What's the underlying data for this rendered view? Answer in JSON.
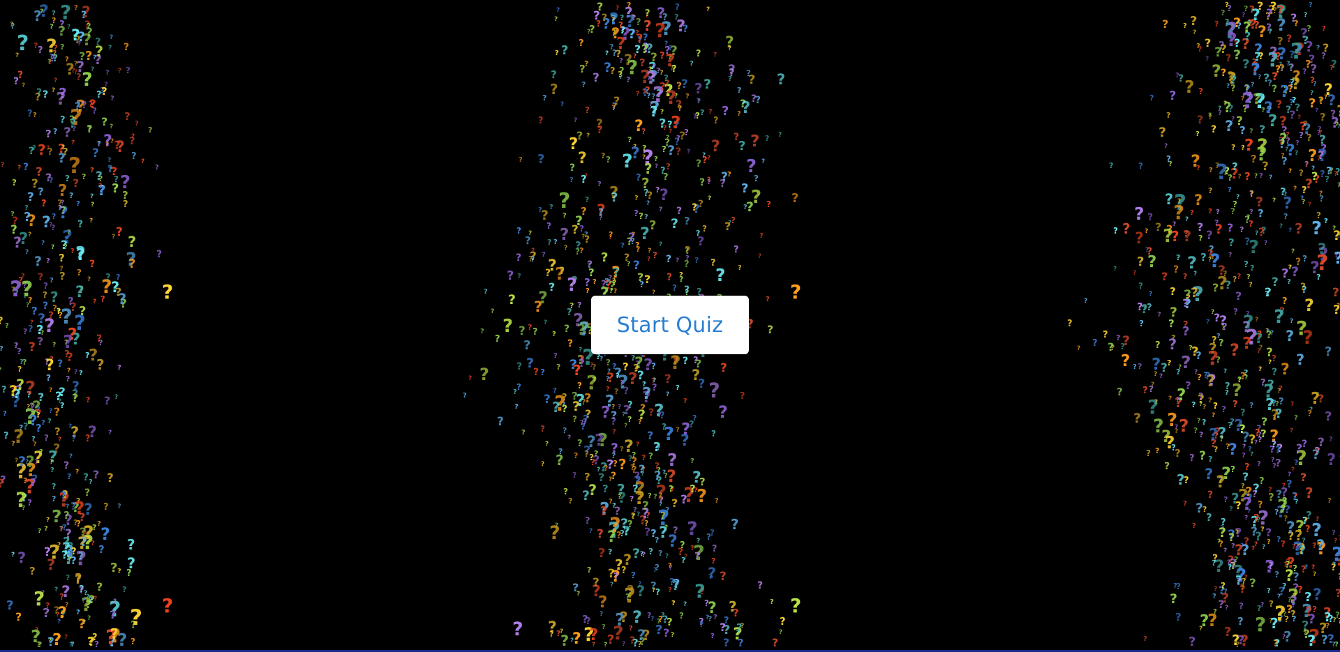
{
  "start_button": {
    "label": "Start Quiz"
  },
  "background": {
    "color": "#000000",
    "symbol": "?",
    "symbol_icon": "question-mark-icon",
    "symbol_colors": [
      "#ffd633",
      "#ff9f1c",
      "#e8431d",
      "#b8e045",
      "#8fd14f",
      "#5fb0e8",
      "#3b7fd9",
      "#66e8f0",
      "#3fa7a0",
      "#b07ee8",
      "#8a5fd0",
      "#c79a1e",
      "#d84a2a"
    ],
    "bottom_bar_color": "#1a2a8a"
  },
  "theme": {
    "button_text_color": "#2a7fd4",
    "button_bg": "#ffffff"
  }
}
